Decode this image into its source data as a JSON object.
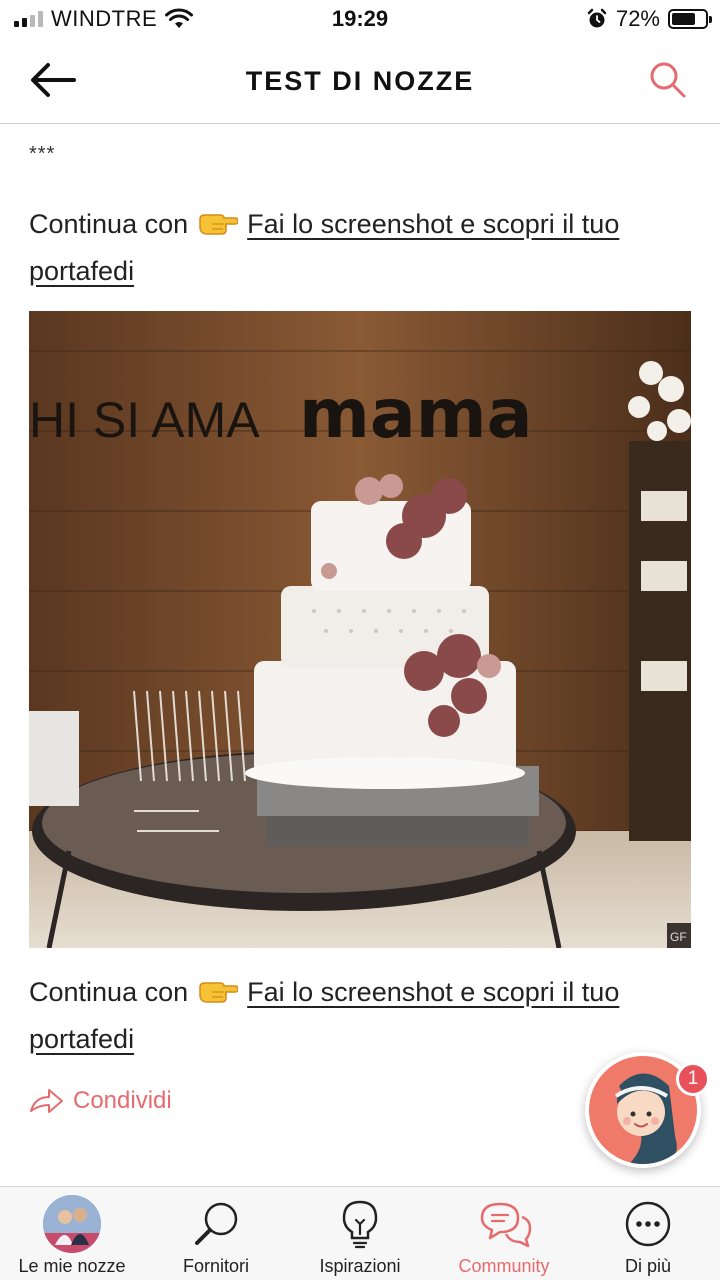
{
  "status_bar": {
    "carrier": "WINDTRE",
    "time": "19:29",
    "battery_percent": "72%",
    "battery_level": 0.72,
    "signal_bars": 2
  },
  "header": {
    "title": "TEST DI NOZZE",
    "back_icon": "arrow-left-icon",
    "search_icon": "search-icon"
  },
  "post": {
    "separator": "***",
    "continue_prefix": "Continua con",
    "emoji": "pointing-hand-emoji",
    "link_text": "Fai lo screenshot e scopri il tuo portafedi",
    "photo": {
      "description": "wedding-cake-photo",
      "sign_text": "HI SI AMA",
      "sign_logo": "mama",
      "corner_tag": "GF"
    },
    "share_label": "Condividi"
  },
  "fab": {
    "badge_count": "1"
  },
  "bottom_nav": {
    "items": [
      {
        "label": "Le mie nozze",
        "icon": "profile-photo",
        "active": false
      },
      {
        "label": "Fornitori",
        "icon": "magnifier-icon",
        "active": false
      },
      {
        "label": "Ispirazioni",
        "icon": "lightbulb-icon",
        "active": false
      },
      {
        "label": "Community",
        "icon": "chat-bubbles-icon",
        "active": true
      },
      {
        "label": "Di più",
        "icon": "more-dots-icon",
        "active": false
      }
    ]
  },
  "colors": {
    "accent": "#e56b6f",
    "text": "#222222",
    "divider": "#cfcfcf"
  }
}
